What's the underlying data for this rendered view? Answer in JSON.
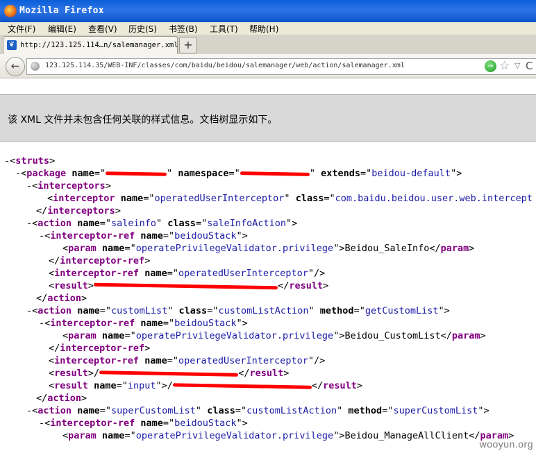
{
  "window": {
    "title": "Mozilla Firefox"
  },
  "menu": [
    "文件(F)",
    "编辑(E)",
    "查看(V)",
    "历史(S)",
    "书签(B)",
    "工具(T)",
    "帮助(H)"
  ],
  "tab": {
    "title": "http://123.125.114…n/salemanager.xml",
    "new_tab_label": "+"
  },
  "nav": {
    "back_label": "←",
    "url": "123.125.114.35/WEB-INF/classes/com/baidu/beidou/salemanager/web/action/salemanager.xml",
    "go_label": "→",
    "bookmark_star": "☆",
    "dropdown_arrow": "▽",
    "reload_label": "C"
  },
  "info_message": "该 XML 文件并未包含任何关联的样式信息。文档树显示如下。",
  "xml": {
    "struts": "struts",
    "package_tag": "package",
    "attr_name": "name",
    "attr_namespace": "namespace",
    "attr_extends": "extends",
    "extends_value": "beidou-default",
    "interceptors": "interceptors",
    "interceptor": "interceptor",
    "operated_interceptor": "operatedUserInterceptor",
    "attr_class": "class",
    "interceptor_class": "com.baidu.beidou.user.web.intercept",
    "action": "action",
    "interceptor_ref": "interceptor-ref",
    "beidou_stack": "beidouStack",
    "param": "param",
    "privilege_name": "operatePrivilegeValidator.privilege",
    "result": "result",
    "attr_method": "method",
    "attr_input": "input",
    "action1_name": "saleinfo",
    "action1_class": "saleInfoAction",
    "action1_privilege": "Beidou_SaleInfo",
    "action2_name": "customList",
    "action2_class": "customListAction",
    "action2_method": "getCustomList",
    "action2_privilege": "Beidou_CustomList",
    "action3_name": "superCustomList",
    "action3_class": "customListAction",
    "action3_method": "superCustomList",
    "action3_privilege": "Beidou_ManageAllClient"
  },
  "watermark": "wooyun.org"
}
